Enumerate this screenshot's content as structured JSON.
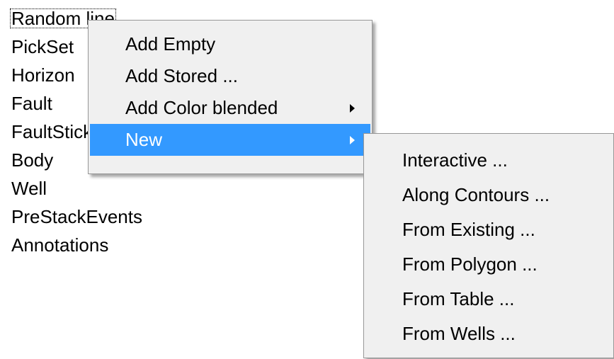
{
  "tree": {
    "items": [
      {
        "label": "Random line"
      },
      {
        "label": "PickSet"
      },
      {
        "label": "Horizon"
      },
      {
        "label": "Fault"
      },
      {
        "label": "FaultStickSet"
      },
      {
        "label": "Body"
      },
      {
        "label": "Well"
      },
      {
        "label": "PreStackEvents"
      },
      {
        "label": "Annotations"
      }
    ]
  },
  "context_menu": {
    "items": [
      {
        "label": "Add Empty"
      },
      {
        "label": "Add Stored ..."
      },
      {
        "label": "Add Color blended"
      },
      {
        "label": "New"
      }
    ]
  },
  "submenu_new": {
    "items": [
      {
        "label": "Interactive  ..."
      },
      {
        "label": "Along Contours ..."
      },
      {
        "label": "From Existing ..."
      },
      {
        "label": "From Polygon ..."
      },
      {
        "label": "From Table ..."
      },
      {
        "label": "From Wells ..."
      }
    ]
  },
  "colors": {
    "highlight": "#3399ff",
    "menu_background": "#f0f0f0",
    "menu_border": "#979797"
  }
}
